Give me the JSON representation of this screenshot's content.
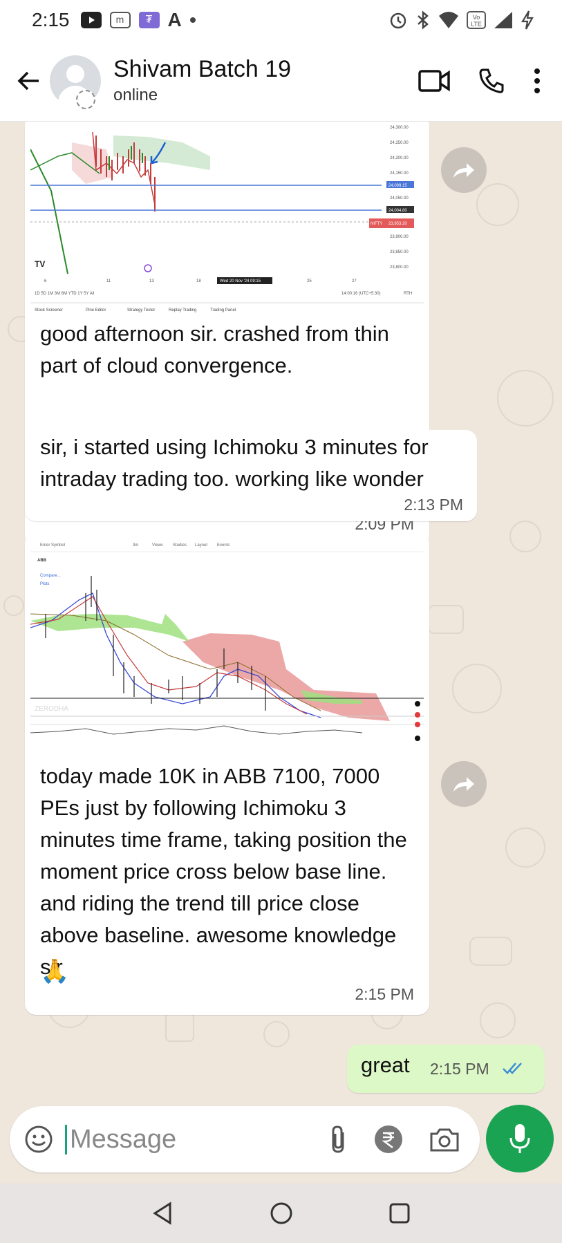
{
  "status_bar": {
    "time": "2:15",
    "app_letter": "A",
    "m_badge": "m",
    "volte_label": "Vo LTE"
  },
  "header": {
    "chat_name": "Shivam Batch 19",
    "presence": "online"
  },
  "messages": [
    {
      "type": "image_text",
      "text": "good afternoon sir. crashed from thin part of cloud convergence.",
      "time": "2:09 PM",
      "chart_labels": {
        "prices": [
          "24,300.00",
          "24,250.00",
          "24,200.00",
          "24,150.00",
          "24,099.15",
          "24,050.00",
          "24,004.80",
          "23,953.20",
          "23,900.00",
          "23,850.00",
          "23,800.00"
        ],
        "nifty_tag": "NIFTY",
        "x_ticks": [
          "6",
          "11",
          "13",
          "18",
          "Wed 20 Nov '24 09:15",
          "25",
          "27"
        ],
        "ranges": "1D 5D 1M 3M 6M YTD 1Y 5Y All",
        "clock": "14:00:16 (UTC+5:30)",
        "rth": "RTH",
        "toolbar": [
          "Stock Screener",
          "Pine Editor",
          "Strategy Tester",
          "Replay Trading",
          "Trading Panel"
        ]
      }
    },
    {
      "type": "text",
      "text": "sir, i started using Ichimoku 3 minutes for intraday trading too. working like wonder",
      "time": "2:13 PM"
    },
    {
      "type": "image_text",
      "text": "today made 10K in ABB 7100, 7000 PEs just by following Ichimoku 3 minutes time frame, taking position the moment price cross below base line. and riding the trend till price close above baseline. awesome knowledge sir",
      "emoji": "🙏",
      "time": "2:15 PM",
      "chart_labels": {
        "search_placeholder": "Enter Symbol",
        "symbol": "ABB",
        "compare": "Compare...",
        "plots": "Plots",
        "toolbar": [
          "3m",
          "Views",
          "Studies",
          "Layout",
          "Events"
        ],
        "watermark": "ZERODHA"
      }
    },
    {
      "type": "outgoing",
      "text": "great",
      "time": "2:15 PM",
      "status": "read"
    }
  ],
  "composer": {
    "placeholder": "Message"
  },
  "colors": {
    "accent_green": "#1aa352",
    "outgoing_bubble": "#dcf8c6",
    "read_tick": "#3c8ed8",
    "wallpaper": "#efe6dc"
  }
}
